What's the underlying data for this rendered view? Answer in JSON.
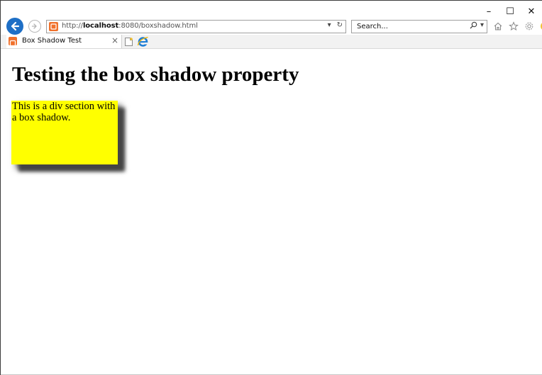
{
  "window": {
    "minimize_glyph": "–",
    "maximize_glyph": "☐",
    "close_glyph": "✕"
  },
  "navigation": {
    "address": {
      "scheme": "http://",
      "host": "localhost",
      "rest": ":8080/boxshadow.html"
    },
    "dropdown_glyph": "▾",
    "refresh_glyph": "↻",
    "search": {
      "placeholder": "Search...",
      "search_glyph": "⚲",
      "dropdown_glyph": "▾"
    },
    "toolbar_icons": [
      "home-icon",
      "favorites-star-icon",
      "settings-gear-icon",
      "smiley-feedback-icon"
    ]
  },
  "tabs": [
    {
      "title": "Box Shadow Test",
      "close_glyph": "×",
      "active": true
    }
  ],
  "page": {
    "heading": "Testing the box shadow property",
    "box_text": "This is a div section with a box shadow.",
    "box_color": "#ffff00"
  },
  "colors": {
    "accent_blue": "#1e6fc6",
    "favicon_orange": "#f0712c"
  }
}
